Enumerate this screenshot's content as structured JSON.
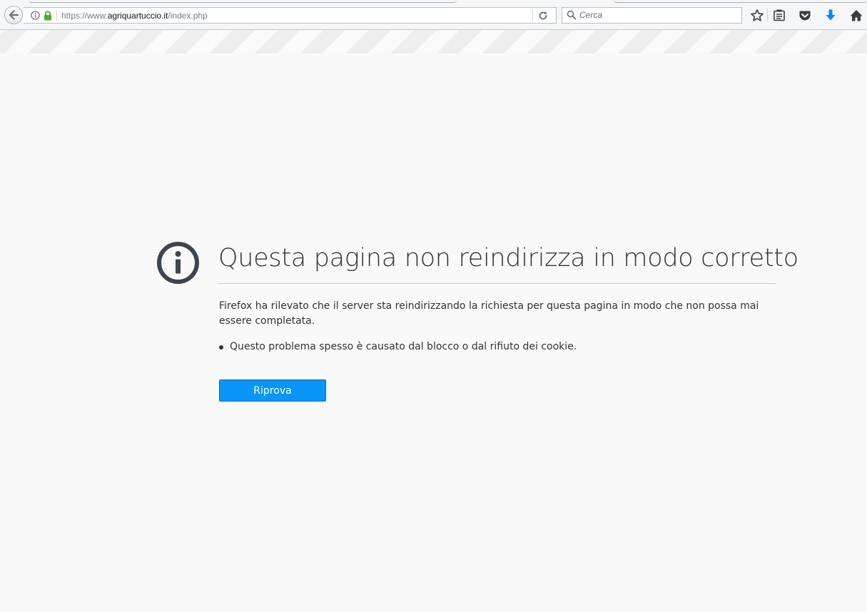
{
  "browser": {
    "url": {
      "prefix": "https://www.",
      "host": "agriquartuccio.it",
      "path": "/index.php"
    },
    "search": {
      "placeholder": "Cerca"
    },
    "icons": {
      "back": "back-arrow-icon",
      "site_info": "info-icon",
      "secure": "lock-icon",
      "reload": "reload-icon",
      "search": "search-icon",
      "bookmark": "star-icon",
      "library": "reading-list-icon",
      "pocket": "pocket-icon",
      "downloads": "download-arrow-icon",
      "home": "home-icon"
    },
    "colors": {
      "secure_lock": "#4fad2c",
      "downloads_accent": "#0a84ff"
    }
  },
  "error_page": {
    "title": "Questa pagina non reindirizza in modo corretto",
    "description": "Firefox ha rilevato che il server sta reindirizzando la richiesta per questa pagina in modo che non possa mai essere completata.",
    "bullets": [
      "Questo problema spesso è causato dal blocco o dal rifiuto dei cookie."
    ],
    "retry_label": "Riprova",
    "colors": {
      "button": "#0996f8",
      "icon": "#3d4550"
    }
  }
}
